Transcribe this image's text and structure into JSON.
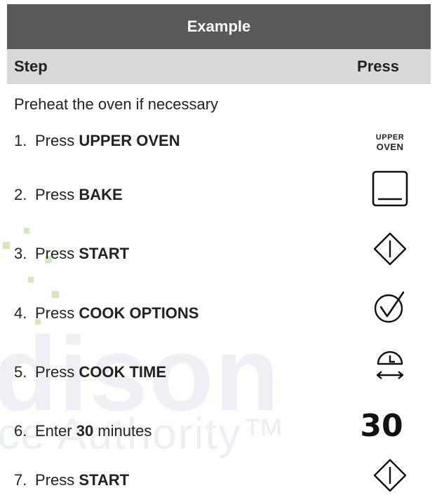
{
  "header": {
    "title": "Example"
  },
  "columns": {
    "step": "Step",
    "press": "Press"
  },
  "intro": "Preheat the oven if necessary",
  "steps": [
    {
      "num": "1.",
      "pre": "Press ",
      "bold": "UPPER OVEN",
      "post": "",
      "icon": "upper-oven-key"
    },
    {
      "num": "2.",
      "pre": "Press ",
      "bold": "BAKE",
      "post": "",
      "icon": "bake-icon"
    },
    {
      "num": "3.",
      "pre": "Press ",
      "bold": "START",
      "post": "",
      "icon": "start-icon"
    },
    {
      "num": "4.",
      "pre": "Press ",
      "bold": "COOK OPTIONS",
      "post": "",
      "icon": "cook-options-icon"
    },
    {
      "num": "5.",
      "pre": "Press ",
      "bold": "COOK TIME",
      "post": "",
      "icon": "cook-time-icon"
    },
    {
      "num": "6.",
      "pre": "Enter ",
      "bold": "30",
      "post": " minutes",
      "icon": "number-30"
    },
    {
      "num": "7.",
      "pre": "Press ",
      "bold": "START",
      "post": "",
      "icon": "start-icon"
    }
  ],
  "upper_oven_key": {
    "line1": "UPPER",
    "line2": "OVEN"
  },
  "big_number": "30",
  "watermark": {
    "line1": "dison",
    "line2": "nce Authority™"
  },
  "colors": {
    "header_bg": "#58595b",
    "subheader_bg": "#d9d9da"
  }
}
